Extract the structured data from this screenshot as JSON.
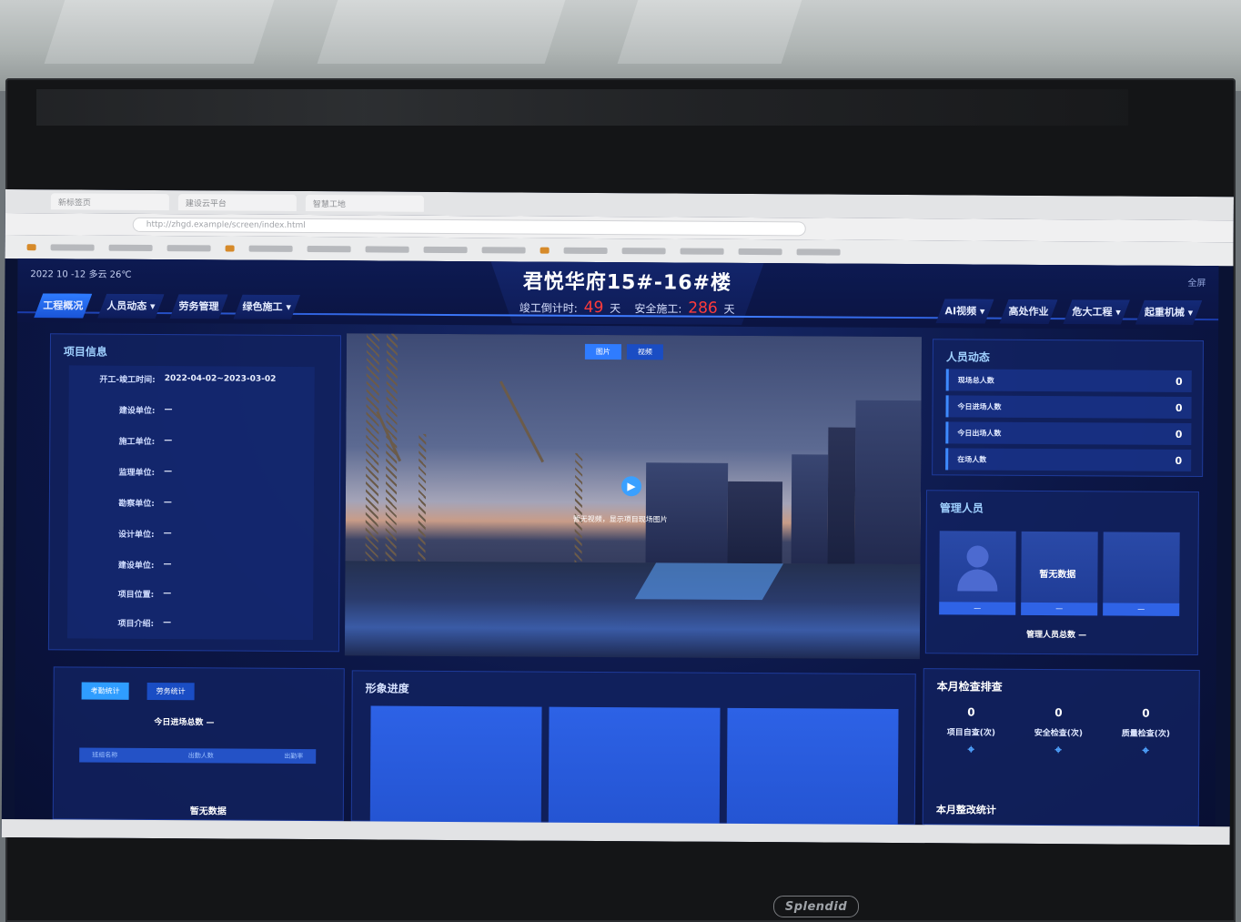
{
  "header": {
    "weather": "2022 10 -12  多云 26℃",
    "fullscreen_label": "全屏",
    "title": "君悦华府15#-16#楼",
    "countdown_label": "竣工倒计时:",
    "countdown_days": "49",
    "countdown_unit": "天",
    "safety_label": "安全施工:",
    "safety_days": "286",
    "safety_unit": "天"
  },
  "nav_left": [
    "工程概况",
    "人员动态 ▾",
    "劳务管理",
    "绿色施工 ▾"
  ],
  "nav_right": [
    "AI视频 ▾",
    "高处作业",
    "危大工程 ▾",
    "起重机械 ▾"
  ],
  "project_info": {
    "title": "项目信息",
    "rows": [
      {
        "label": "开工-竣工时间:",
        "value": "2022-04-02~2023-03-02"
      },
      {
        "label": "建设单位:",
        "value": "—"
      },
      {
        "label": "施工单位:",
        "value": "—"
      },
      {
        "label": "监理单位:",
        "value": "—"
      },
      {
        "label": "勘察单位:",
        "value": "—"
      },
      {
        "label": "设计单位:",
        "value": "—"
      },
      {
        "label": "建设单位:",
        "value": "—"
      },
      {
        "label": "项目位置:",
        "value": "—"
      },
      {
        "label": "项目介绍:",
        "value": "—"
      }
    ]
  },
  "video": {
    "tabs": [
      "图片",
      "视频"
    ],
    "hint": "暂无视频，显示项目现场图片"
  },
  "people": {
    "title": "人员动态",
    "rows": [
      {
        "label": "现场总人数",
        "value": "0"
      },
      {
        "label": "今日进场人数",
        "value": "0"
      },
      {
        "label": "今日出场人数",
        "value": "0"
      },
      {
        "label": "在场人数",
        "value": "0"
      }
    ]
  },
  "managers": {
    "title": "管理人员",
    "cards": [
      "—",
      "—",
      "—"
    ],
    "center_label": "暂无数据",
    "count_label": "管理人员总数 —"
  },
  "bottom_left": {
    "tabs": [
      "考勤统计",
      "劳务统计"
    ],
    "today_label": "今日进场总数 —",
    "columns": [
      "班组名称",
      "出勤人数",
      "出勤率"
    ],
    "empty": "暂无数据"
  },
  "progress": {
    "title": "形象进度"
  },
  "inspection": {
    "title": "本月检查排查",
    "stats": [
      {
        "value": "0",
        "label": "项目自查(次)"
      },
      {
        "value": "0",
        "label": "安全检查(次)"
      },
      {
        "value": "0",
        "label": "质量检查(次)"
      }
    ],
    "sub_title": "本月整改统计"
  },
  "browser": {
    "tabs": [
      "新标签页",
      "建设云平台",
      "智慧工地"
    ],
    "url": "http://zhgd.example/screen/index.html"
  },
  "monitor_brand": "Splendid"
}
